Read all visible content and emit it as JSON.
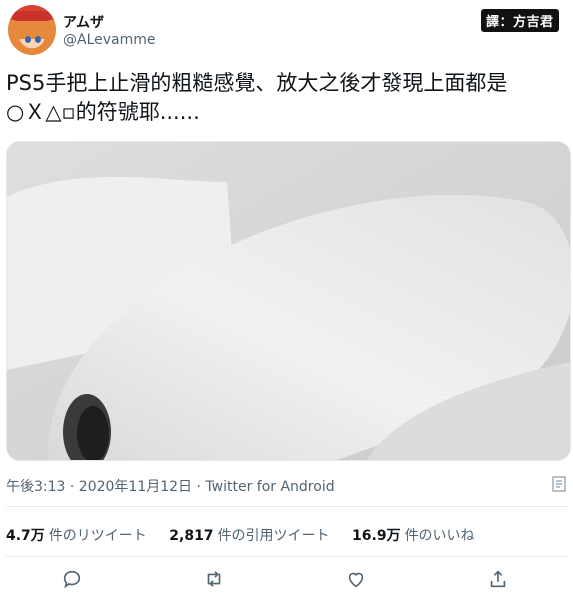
{
  "user": {
    "display_name": "アムザ",
    "handle": "@ALevamme"
  },
  "credit_badge": "譯：方吉君",
  "tweet": {
    "text_line1": "PS5手把上止滑的粗糙感覺、放大之後才發現上面都是",
    "text_line2": "○Ｘ△▫的符號耶......",
    "image_alt": "close-up of white PS5 controller grip texture"
  },
  "meta": {
    "timestamp": "午後3:13 · 2020年11月12日 · Twitter for Android"
  },
  "stats": [
    {
      "value": "4.7万",
      "label": "件のリツイート"
    },
    {
      "value": "2,817",
      "label": "件の引用ツイート"
    },
    {
      "value": "16.9万",
      "label": "件のいいね"
    }
  ],
  "actions": [
    "reply-icon",
    "retweet-icon",
    "like-icon",
    "share-icon"
  ]
}
